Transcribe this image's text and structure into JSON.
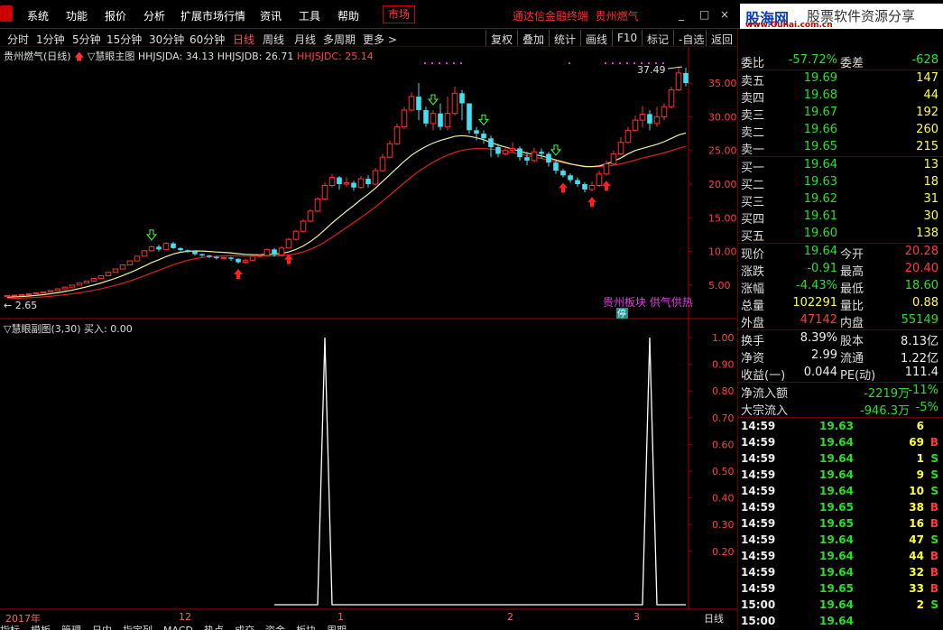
{
  "menu": {
    "items": [
      "系统",
      "功能",
      "报价",
      "分析",
      "扩展市场行情",
      "资讯",
      "工具",
      "帮助"
    ],
    "market": "市场",
    "app_title": "通达信金融终端",
    "stock_title": "贵州燃气"
  },
  "site_brand": {
    "name": "股海网",
    "slogan": "股票软件资源分享",
    "url": "www.Guhai.com.cn"
  },
  "period_bar": {
    "periods": [
      "分时",
      "1分钟",
      "5分钟",
      "15分钟",
      "30分钟",
      "60分钟",
      "日线",
      "周线",
      "月线",
      "多周期",
      "更多 >"
    ],
    "active": "日线",
    "tools": [
      "复权",
      "叠加",
      "统计",
      "画线",
      "F10",
      "标记",
      "-自选",
      "返回"
    ]
  },
  "main_legend": {
    "title": "贵州燃气(日线)",
    "indicator": "▽慧眼主图",
    "a_label": "HHJSJDA: 34.13",
    "b_label": "HHJSJDB: 26.71",
    "c_label": "HHJSJDC: 25.14"
  },
  "main_axis": {
    "ticks": [
      "35.00",
      "30.00",
      "25.00",
      "20.00",
      "15.00",
      "10.00",
      "5.00"
    ],
    "high_label": "37.49",
    "low_label": "← 2.65",
    "sector_text": "贵州板块 供气供热",
    "limit_badge": "停"
  },
  "sub_legend": {
    "title": "▽慧眼副图(3,30)",
    "buy": "买入: 0.00"
  },
  "sub_axis": {
    "ticks": [
      "1.00",
      "0.90",
      "0.80",
      "0.70",
      "0.60",
      "0.50",
      "0.40",
      "0.30",
      "0.20"
    ]
  },
  "date_axis": {
    "labels": [
      "2017年",
      "12",
      "1",
      "2",
      "3"
    ],
    "period": "日线"
  },
  "bottom_tabs": [
    "指标",
    "模板",
    "管理",
    "日内",
    "指定列",
    "MACD",
    "热点",
    "成交",
    "资金",
    "板块",
    "周期"
  ],
  "quote": {
    "wb": {
      "label": "委比",
      "value": "-57.72%",
      "label2": "委差",
      "value2": "-628"
    },
    "sell": [
      {
        "label": "卖五",
        "price": "19.69",
        "vol": "147"
      },
      {
        "label": "卖四",
        "price": "19.68",
        "vol": "44"
      },
      {
        "label": "卖三",
        "price": "19.67",
        "vol": "192"
      },
      {
        "label": "卖二",
        "price": "19.66",
        "vol": "260"
      },
      {
        "label": "卖一",
        "price": "19.65",
        "vol": "215"
      }
    ],
    "buy": [
      {
        "label": "买一",
        "price": "19.64",
        "vol": "13"
      },
      {
        "label": "买二",
        "price": "19.63",
        "vol": "18"
      },
      {
        "label": "买三",
        "price": "19.62",
        "vol": "31"
      },
      {
        "label": "买四",
        "price": "19.61",
        "vol": "30"
      },
      {
        "label": "买五",
        "price": "19.60",
        "vol": "138"
      }
    ],
    "stats": [
      {
        "l1": "现价",
        "v1": "19.64",
        "c1": "green",
        "l2": "今开",
        "v2": "20.28",
        "c2": "red"
      },
      {
        "l1": "涨跌",
        "v1": "-0.91",
        "c1": "green",
        "l2": "最高",
        "v2": "20.40",
        "c2": "red"
      },
      {
        "l1": "涨幅",
        "v1": "-4.43%",
        "c1": "green",
        "l2": "最低",
        "v2": "18.60",
        "c2": "green"
      },
      {
        "l1": "总量",
        "v1": "102291",
        "c1": "yellow",
        "l2": "量比",
        "v2": "0.88",
        "c2": "yellow"
      },
      {
        "l1": "外盘",
        "v1": "47142",
        "c1": "red",
        "l2": "内盘",
        "v2": "55149",
        "c2": "green"
      }
    ],
    "stats2": [
      {
        "l1": "换手",
        "v1": "8.39%",
        "l2": "股本",
        "v2": "8.13亿"
      },
      {
        "l1": "净资",
        "v1": "2.99",
        "l2": "流通",
        "v2": "1.22亿"
      },
      {
        "l1": "收益(一)",
        "v1": "0.044",
        "l2": "PE(动)",
        "v2": "111.4"
      }
    ],
    "flow": [
      {
        "label": "净流入额",
        "value": "-2219万",
        "pct": "-11%"
      },
      {
        "label": "大宗流入",
        "value": "-946.3万",
        "pct": "-5%"
      }
    ]
  },
  "ticks": [
    {
      "t": "14:59",
      "p": "19.63",
      "v": "6",
      "s": ""
    },
    {
      "t": "14:59",
      "p": "19.64",
      "v": "69",
      "s": "B"
    },
    {
      "t": "14:59",
      "p": "19.64",
      "v": "1",
      "s": "S"
    },
    {
      "t": "14:59",
      "p": "19.64",
      "v": "9",
      "s": "S"
    },
    {
      "t": "14:59",
      "p": "19.64",
      "v": "10",
      "s": "S"
    },
    {
      "t": "14:59",
      "p": "19.65",
      "v": "38",
      "s": "B"
    },
    {
      "t": "14:59",
      "p": "19.65",
      "v": "16",
      "s": "B"
    },
    {
      "t": "14:59",
      "p": "19.64",
      "v": "47",
      "s": "S"
    },
    {
      "t": "14:59",
      "p": "19.64",
      "v": "44",
      "s": "B"
    },
    {
      "t": "14:59",
      "p": "19.64",
      "v": "32",
      "s": "B"
    },
    {
      "t": "14:59",
      "p": "19.65",
      "v": "33",
      "s": "B"
    },
    {
      "t": "15:00",
      "p": "19.64",
      "v": "2",
      "s": "S"
    },
    {
      "t": "15:00",
      "p": "19.64",
      "v": "",
      "s": ""
    }
  ],
  "chart_data": {
    "type": "candlestick",
    "candles": [
      [
        3.4,
        3.45,
        3.3,
        3.2
      ],
      [
        3.45,
        3.5,
        3.6,
        3.4
      ],
      [
        3.5,
        3.6,
        3.65,
        3.45
      ],
      [
        3.6,
        3.7,
        3.8,
        3.55
      ],
      [
        3.7,
        3.85,
        3.9,
        3.65
      ],
      [
        3.85,
        4.0,
        4.05,
        3.8
      ],
      [
        4.0,
        4.2,
        4.25,
        3.95
      ],
      [
        4.2,
        4.45,
        4.5,
        4.15
      ],
      [
        4.45,
        4.7,
        4.75,
        4.4
      ],
      [
        4.7,
        5.0,
        5.05,
        4.65
      ],
      [
        5.0,
        5.3,
        5.35,
        4.95
      ],
      [
        5.3,
        5.6,
        5.65,
        5.25
      ],
      [
        5.6,
        6.0,
        6.05,
        5.55
      ],
      [
        6.0,
        6.4,
        6.45,
        5.95
      ],
      [
        6.4,
        6.9,
        6.95,
        6.35
      ],
      [
        6.9,
        7.4,
        7.45,
        6.85
      ],
      [
        7.4,
        8.0,
        8.05,
        7.35
      ],
      [
        8.0,
        8.6,
        8.65,
        7.95
      ],
      [
        8.6,
        9.3,
        9.35,
        8.55
      ],
      [
        9.3,
        10.1,
        10.2,
        9.25
      ],
      [
        10.1,
        10.7,
        10.9,
        10.0
      ],
      [
        10.7,
        10.3,
        11.0,
        10.0
      ],
      [
        10.3,
        11.2,
        11.4,
        10.2
      ],
      [
        11.2,
        10.5,
        11.4,
        10.4
      ],
      [
        10.5,
        10.2,
        10.6,
        10.0
      ],
      [
        10.2,
        10.0,
        10.3,
        9.8
      ],
      [
        10.0,
        9.6,
        10.1,
        9.4
      ],
      [
        9.6,
        9.4,
        9.7,
        9.2
      ],
      [
        9.4,
        9.2,
        9.5,
        9.0
      ],
      [
        9.2,
        9.0,
        9.3,
        8.8
      ],
      [
        9.0,
        9.1,
        9.2,
        8.8
      ],
      [
        9.1,
        8.9,
        9.2,
        8.6
      ],
      [
        8.9,
        8.4,
        9.0,
        8.2
      ],
      [
        8.4,
        8.7,
        8.9,
        8.2
      ],
      [
        8.7,
        9.3,
        9.4,
        8.6
      ],
      [
        9.3,
        9.4,
        9.6,
        9.1
      ],
      [
        9.4,
        10.3,
        10.4,
        9.2
      ],
      [
        10.3,
        9.5,
        10.5,
        9.2
      ],
      [
        9.5,
        10.5,
        10.8,
        9.4
      ],
      [
        10.5,
        11.8,
        12.0,
        10.4
      ],
      [
        11.8,
        13.0,
        13.2,
        11.6
      ],
      [
        13.0,
        14.5,
        14.8,
        12.8
      ],
      [
        14.5,
        16.0,
        16.3,
        14.3
      ],
      [
        16.0,
        17.8,
        18.0,
        15.8
      ],
      [
        17.8,
        19.8,
        20.2,
        17.6
      ],
      [
        19.8,
        21.0,
        21.5,
        19.5
      ],
      [
        21.0,
        20.0,
        21.2,
        19.2
      ],
      [
        20.0,
        20.2,
        21.0,
        19.6
      ],
      [
        20.2,
        19.5,
        20.5,
        19.0
      ],
      [
        19.5,
        20.8,
        21.2,
        19.3
      ],
      [
        20.8,
        20.0,
        21.3,
        19.5
      ],
      [
        20.0,
        22.0,
        22.4,
        19.8
      ],
      [
        22.0,
        24.0,
        24.5,
        21.8
      ],
      [
        24.0,
        26.0,
        26.5,
        23.8
      ],
      [
        26.0,
        28.5,
        29.0,
        25.8
      ],
      [
        28.5,
        31.0,
        31.5,
        28.2
      ],
      [
        31.0,
        33.0,
        33.6,
        30.8
      ],
      [
        33.0,
        31.0,
        35.0,
        29.5
      ],
      [
        31.0,
        29.0,
        31.5,
        28.5
      ],
      [
        29.0,
        30.5,
        31.0,
        28.0
      ],
      [
        30.5,
        28.5,
        32.0,
        28.0
      ],
      [
        28.5,
        30.5,
        33.0,
        28.0
      ],
      [
        30.5,
        33.5,
        34.5,
        30.2
      ],
      [
        33.5,
        32.0,
        34.0,
        29.5
      ],
      [
        32.0,
        28.0,
        32.0,
        27.5
      ],
      [
        28.0,
        27.5,
        28.5,
        26.5
      ],
      [
        27.5,
        26.8,
        28.0,
        26.0
      ],
      [
        26.8,
        25.5,
        27.2,
        24.0
      ],
      [
        25.5,
        24.5,
        26.0,
        24.0
      ],
      [
        24.5,
        25.0,
        25.5,
        24.2
      ],
      [
        25.0,
        25.3,
        26.2,
        24.6
      ],
      [
        25.3,
        24.0,
        25.6,
        23.5
      ],
      [
        24.0,
        23.5,
        24.8,
        22.8
      ],
      [
        23.5,
        24.8,
        25.4,
        23.2
      ],
      [
        24.8,
        24.5,
        25.3,
        23.8
      ],
      [
        24.5,
        23.2,
        24.8,
        22.6
      ],
      [
        23.2,
        22.0,
        23.5,
        21.5
      ],
      [
        22.0,
        21.3,
        22.3,
        21.0
      ],
      [
        21.3,
        20.6,
        21.6,
        20.2
      ],
      [
        20.6,
        20.0,
        21.0,
        19.6
      ],
      [
        20.0,
        19.2,
        20.3,
        18.8
      ],
      [
        19.2,
        19.8,
        20.4,
        18.9
      ],
      [
        19.8,
        21.5,
        22.0,
        19.6
      ],
      [
        21.5,
        23.0,
        23.5,
        21.3
      ],
      [
        23.0,
        24.5,
        25.0,
        22.8
      ],
      [
        24.5,
        26.2,
        27.0,
        24.3
      ],
      [
        26.2,
        28.0,
        28.5,
        26.0
      ],
      [
        28.0,
        29.5,
        30.2,
        27.8
      ],
      [
        29.5,
        30.4,
        31.6,
        28.4
      ],
      [
        30.4,
        29.0,
        31.0,
        28.0
      ],
      [
        29.0,
        30.0,
        31.5,
        28.5
      ],
      [
        30.0,
        31.5,
        32.0,
        29.5
      ],
      [
        31.5,
        34.0,
        34.5,
        31.2
      ],
      [
        34.0,
        36.5,
        37.49,
        33.8
      ],
      [
        36.5,
        35.0,
        37.3,
        34.5
      ]
    ],
    "ma_fast": [
      3.2,
      3.25,
      3.3,
      3.38,
      3.47,
      3.58,
      3.72,
      3.88,
      4.06,
      4.26,
      4.49,
      4.74,
      5.02,
      5.32,
      5.66,
      6.02,
      6.42,
      6.86,
      7.32,
      7.82,
      8.34,
      8.76,
      9.24,
      9.62,
      9.88,
      10.02,
      10.08,
      10.06,
      10.0,
      9.92,
      9.86,
      9.78,
      9.66,
      9.56,
      9.52,
      9.5,
      9.58,
      9.6,
      9.7,
      9.94,
      10.3,
      10.82,
      11.48,
      12.28,
      13.22,
      14.22,
      15.12,
      16.0,
      16.82,
      17.7,
      18.5,
      19.4,
      20.4,
      21.4,
      22.4,
      23.4,
      24.3,
      25.0,
      25.6,
      26.1,
      26.5,
      26.8,
      27.1,
      27.2,
      27.1,
      26.9,
      26.6,
      26.2,
      25.8,
      25.5,
      25.2,
      24.9,
      24.6,
      24.4,
      24.2,
      23.9,
      23.6,
      23.3,
      23.0,
      22.8,
      22.6,
      22.6,
      22.7,
      23.0,
      23.4,
      23.9,
      24.5,
      25.0,
      25.3,
      25.6,
      25.9,
      26.3,
      26.8,
      27.3,
      27.6
    ],
    "ma_slow": [
      3.0,
      3.03,
      3.07,
      3.12,
      3.18,
      3.25,
      3.34,
      3.45,
      3.57,
      3.71,
      3.86,
      4.04,
      4.24,
      4.46,
      4.71,
      4.98,
      5.28,
      5.62,
      5.98,
      6.38,
      6.8,
      7.2,
      7.62,
      8.02,
      8.38,
      8.68,
      8.92,
      9.1,
      9.22,
      9.3,
      9.34,
      9.36,
      9.34,
      9.32,
      9.3,
      9.3,
      9.32,
      9.34,
      9.38,
      9.48,
      9.66,
      9.94,
      10.32,
      10.82,
      11.42,
      12.1,
      12.82,
      13.56,
      14.3,
      15.06,
      15.82,
      16.62,
      17.48,
      18.36,
      19.28,
      20.2,
      21.1,
      21.9,
      22.62,
      23.26,
      23.82,
      24.3,
      24.72,
      25.02,
      25.2,
      25.28,
      25.28,
      25.2,
      25.06,
      24.88,
      24.68,
      24.46,
      24.22,
      24.0,
      23.8,
      23.6,
      23.4,
      23.2,
      23.0,
      22.82,
      22.68,
      22.6,
      22.6,
      22.66,
      22.8,
      23.0,
      23.28,
      23.58,
      23.86,
      24.12,
      24.38,
      24.66,
      24.98,
      25.3,
      25.6
    ],
    "up_arrows": [
      32,
      39,
      77,
      81,
      83
    ],
    "down_arrows": [
      20,
      59,
      66,
      76
    ],
    "buy_signal": [
      {
        "x": 43,
        "y": 0
      },
      {
        "x": 44,
        "y": 1.0
      },
      {
        "x": 45,
        "y": 0
      },
      {
        "x": 88,
        "y": 0
      },
      {
        "x": 89,
        "y": 1.0
      },
      {
        "x": 90,
        "y": 0
      }
    ]
  }
}
